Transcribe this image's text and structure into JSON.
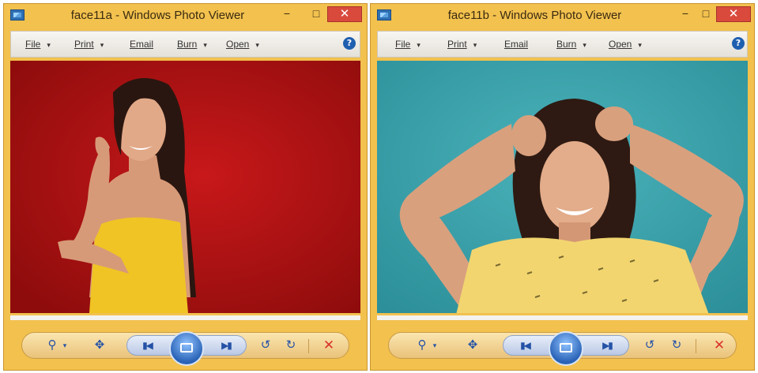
{
  "windows": [
    {
      "title": "face11a - Windows Photo Viewer",
      "menu": [
        "File",
        "Print",
        "Email",
        "Burn",
        "Open"
      ],
      "help": "?",
      "background_color": "#b81414"
    },
    {
      "title": "face11b - Windows Photo Viewer",
      "menu": [
        "File",
        "Print",
        "Email",
        "Burn",
        "Open"
      ],
      "help": "?",
      "background_color": "#3aa1ab"
    }
  ],
  "titlebar_buttons": {
    "minimize": "−",
    "maximize": "□",
    "close": "✕"
  },
  "toolbar_icons": {
    "zoom": "magnifier-icon",
    "actual_size": "actual-size-icon",
    "previous": "previous-icon",
    "slideshow": "slideshow-icon",
    "next": "next-icon",
    "rotate_ccw": "rotate-counterclockwise-icon",
    "rotate_cw": "rotate-clockwise-icon",
    "delete": "delete-icon"
  },
  "glyphs": {
    "zoom": "⚲",
    "dropdown": "▾",
    "actual_size": "✥",
    "prev": "▮◀",
    "next": "▶▮",
    "rot_ccw": "↺",
    "rot_cw": "↻",
    "delete": "✕"
  }
}
